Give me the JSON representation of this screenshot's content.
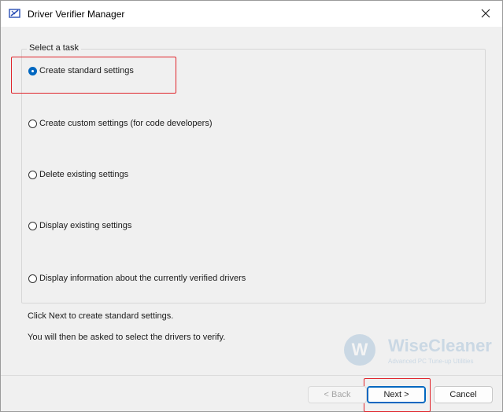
{
  "window": {
    "title": "Driver Verifier Manager",
    "icon": "driver-verifier-icon",
    "close_icon": "close-icon"
  },
  "group": {
    "label": "Select a task"
  },
  "options": [
    {
      "label": "Create standard settings",
      "selected": true
    },
    {
      "label": "Create custom settings (for code developers)",
      "selected": false
    },
    {
      "label": "Delete existing settings",
      "selected": false
    },
    {
      "label": "Display existing settings",
      "selected": false
    },
    {
      "label": "Display information about the currently verified drivers",
      "selected": false
    }
  ],
  "info": {
    "line1": "Click Next to create standard settings.",
    "line2": "You will then be asked to select the drivers to verify."
  },
  "buttons": {
    "back": "< Back",
    "next": "Next >",
    "cancel": "Cancel"
  },
  "watermark": {
    "brand": "WiseCleaner",
    "tagline": "Advanced PC Tune-up Utilities",
    "logo_letter": "W"
  },
  "colors": {
    "accent": "#0067c0",
    "highlight": "#e0242b"
  }
}
